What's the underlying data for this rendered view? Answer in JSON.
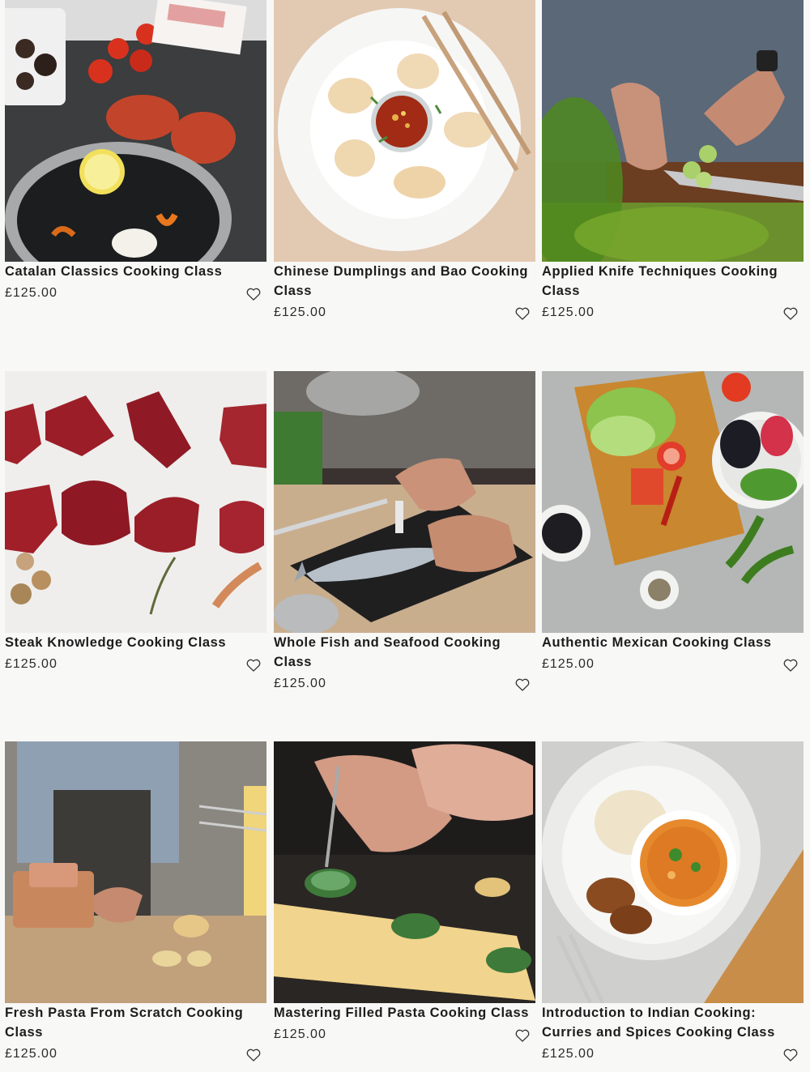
{
  "products": [
    {
      "title": "Catalan Classics Cooking Class",
      "price": "£125.00",
      "image": "catalan-dishes-photo"
    },
    {
      "title": "Chinese Dumplings and Bao Cooking Class",
      "price": "£125.00",
      "image": "dumplings-plate-photo"
    },
    {
      "title": "Applied Knife Techniques Cooking Class",
      "price": "£125.00",
      "image": "knife-cucumber-photo"
    },
    {
      "title": "Steak Knowledge Cooking Class",
      "price": "£125.00",
      "image": "steak-cuts-photo"
    },
    {
      "title": "Whole Fish and Seafood Cooking Class",
      "price": "£125.00",
      "image": "fish-filleting-photo"
    },
    {
      "title": "Authentic Mexican Cooking Class",
      "price": "£125.00",
      "image": "mexican-ingredients-photo"
    },
    {
      "title": "Fresh Pasta From Scratch Cooking Class",
      "price": "£125.00",
      "image": "pasta-machine-photo"
    },
    {
      "title": "Mastering Filled Pasta Cooking Class",
      "price": "£125.00",
      "image": "filled-pasta-photo"
    },
    {
      "title": "Introduction to Indian Cooking: Curries and Spices Cooking Class",
      "price": "£125.00",
      "image": "indian-curry-photo"
    }
  ],
  "icons": {
    "wishlist": "heart-outline-icon"
  },
  "colors": {
    "background": "#f8f8f7",
    "text": "#1c1c1c"
  }
}
